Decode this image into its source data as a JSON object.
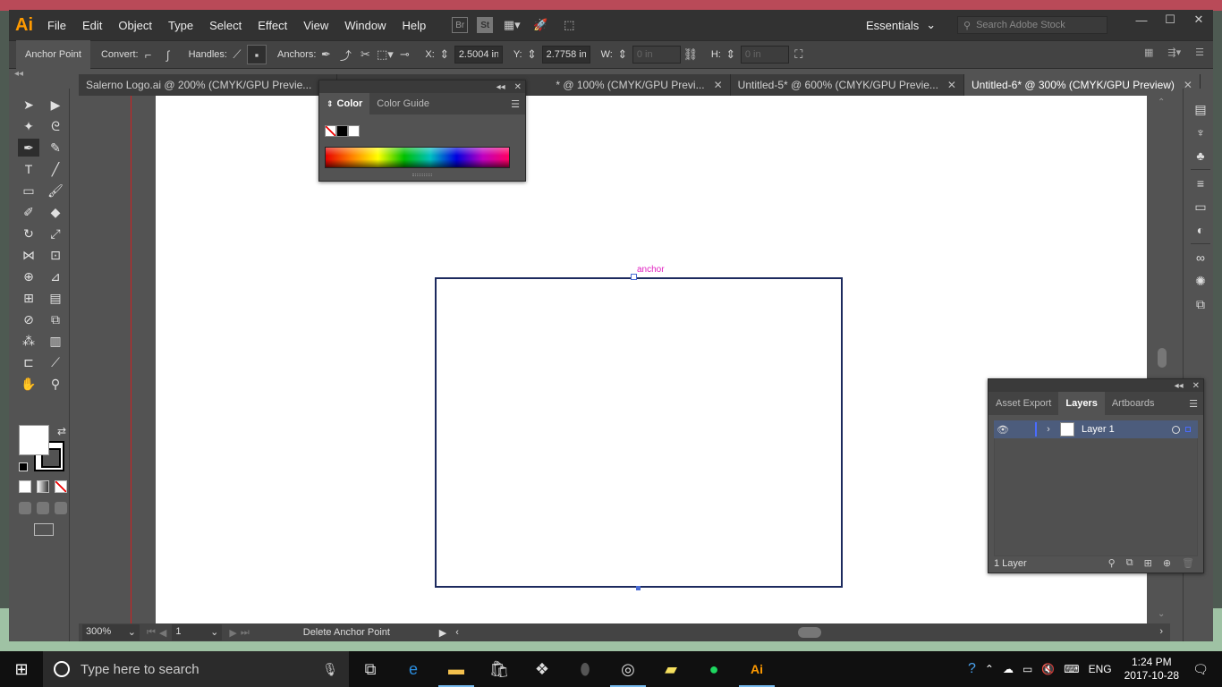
{
  "app": {
    "logo": "Ai",
    "menu": [
      "File",
      "Edit",
      "Object",
      "Type",
      "Select",
      "Effect",
      "View",
      "Window",
      "Help"
    ],
    "workspace": "Essentials",
    "stock_search_placeholder": "Search Adobe Stock"
  },
  "control_bar": {
    "tool_name": "Anchor Point",
    "convert_label": "Convert:",
    "handles_label": "Handles:",
    "anchors_label": "Anchors:",
    "x_label": "X:",
    "x_value": "2.5004 in",
    "y_label": "Y:",
    "y_value": "2.7758 in",
    "w_label": "W:",
    "w_value": "0 in",
    "h_label": "H:",
    "h_value": "0 in"
  },
  "tabs": [
    {
      "label": "Salerno Logo.ai @ 200% (CMYK/GPU Previe...",
      "active": false
    },
    {
      "label": "* @ 100% (CMYK/GPU Previ...",
      "active": false
    },
    {
      "label": "Untitled-5* @ 600% (CMYK/GPU Previe...",
      "active": false
    },
    {
      "label": "Untitled-6* @ 300% (CMYK/GPU Preview)",
      "active": true
    }
  ],
  "color_panel": {
    "tabs": [
      "Color",
      "Color Guide"
    ],
    "active_tab": "Color"
  },
  "canvas": {
    "anchor_label": "anchor"
  },
  "status_bar": {
    "zoom": "300%",
    "artboard": "1",
    "status_text": "Delete Anchor Point"
  },
  "layers_panel": {
    "tabs": [
      "Asset Export",
      "Layers",
      "Artboards"
    ],
    "active_tab": "Layers",
    "layers": [
      {
        "name": "Layer 1"
      }
    ],
    "footer_count": "1 Layer"
  },
  "taskbar": {
    "search_placeholder": "Type here to search",
    "language": "ENG",
    "time": "1:24 PM",
    "date": "2017-10-28"
  },
  "colors": {
    "app_dark": "#323232",
    "panel_bg": "#535353",
    "ai_orange": "#ff9a00",
    "guide_red": "#d02020",
    "anchor_magenta": "#e020c0",
    "layer_selection": "#4c5c7c"
  }
}
